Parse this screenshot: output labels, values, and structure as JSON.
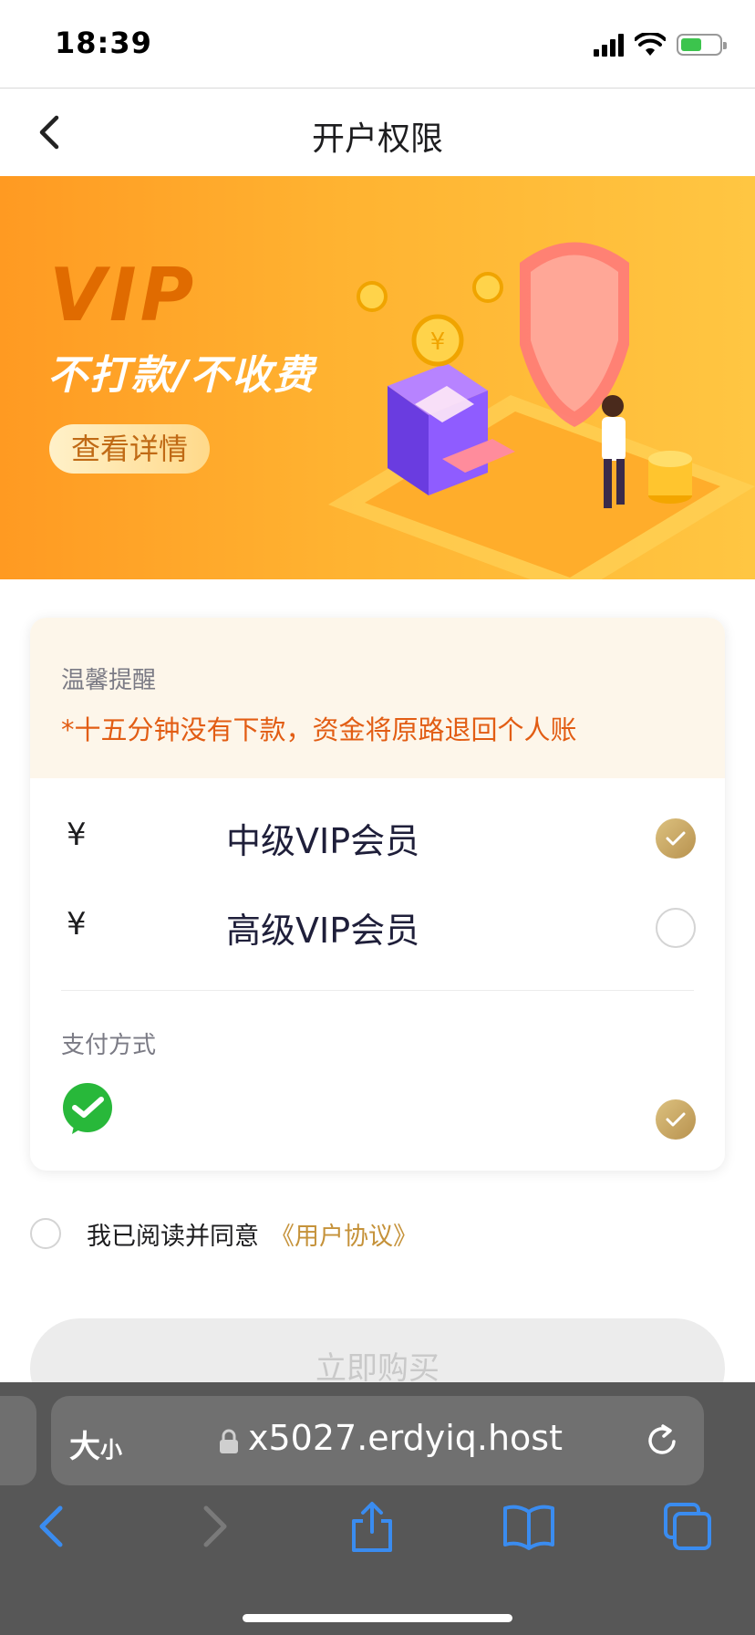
{
  "status": {
    "time": "18:39"
  },
  "nav": {
    "title": "开户权限"
  },
  "banner": {
    "vip": "VIP",
    "slogan": "不打款/不收费",
    "detail_button": "查看详情"
  },
  "notice": {
    "title": "温馨提醒",
    "text": "*十五分钟没有下款，资金将原路退回个人账"
  },
  "plans": [
    {
      "currency": "¥",
      "name": "中级VIP会员",
      "selected": true
    },
    {
      "currency": "¥",
      "name": "高级VIP会员",
      "selected": false
    }
  ],
  "payment": {
    "label": "支付方式",
    "method_icon": "wechat-pay-icon",
    "selected": true
  },
  "agreement": {
    "text": "我已阅读并同意",
    "link": "《用户协议》"
  },
  "buy_button": "立即购买",
  "browser": {
    "text_size": "大",
    "text_size_small": "小",
    "url": "x5027.erdyiq.host"
  },
  "colors": {
    "accent_gold": "#c5923a",
    "warning": "#e25d14",
    "banner_orange": "#ffa52a",
    "wechat_green": "#28b83a"
  }
}
